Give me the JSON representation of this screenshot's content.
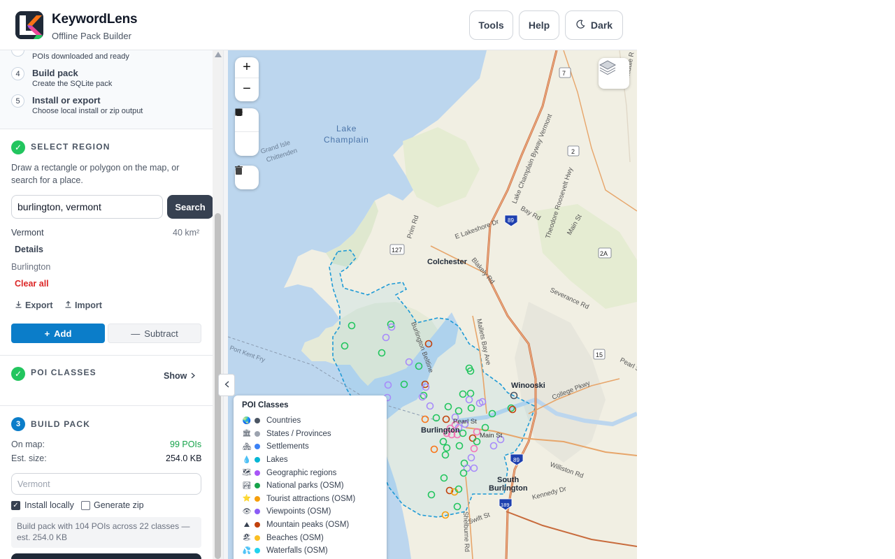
{
  "app": {
    "title": "KeywordLens",
    "subtitle": "Offline Pack Builder",
    "buttons": {
      "tools": "Tools",
      "help": "Help",
      "dark": "Dark"
    }
  },
  "steps": [
    {
      "num": "",
      "title": "",
      "desc": "POIs downloaded and ready"
    },
    {
      "num": "4",
      "title": "Build pack",
      "desc": "Create the SQLite pack"
    },
    {
      "num": "5",
      "title": "Install or export",
      "desc": "Choose local install or zip output"
    }
  ],
  "select_region": {
    "title": "SELECT REGION",
    "description": "Draw a rectangle or polygon on the map, or search for a place.",
    "search_value": "burlington, vermont",
    "search_button": "Search",
    "region_name": "Vermont",
    "region_area": "40 km²",
    "details_label": "Details",
    "place": "Burlington",
    "clear_all": "Clear all",
    "export_label": "Export",
    "import_label": "Import",
    "add_label": "Add",
    "subtract_label": "Subtract"
  },
  "poi_classes": {
    "title": "POI CLASSES",
    "show_label": "Show"
  },
  "build_pack": {
    "num": "3",
    "title": "BUILD PACK",
    "on_map_label": "On map:",
    "on_map_value": "99 POIs",
    "est_size_label": "Est. size:",
    "est_size_value": "254.0 KB",
    "name_placeholder": "Vermont",
    "install_locally": "Install locally",
    "generate_zip": "Generate zip",
    "summary": "Build pack with 104 POIs across 22 classes — est. 254.0 KB"
  },
  "map": {
    "zoom_in": "+",
    "zoom_out": "−",
    "labels": {
      "lake": "Lake",
      "champlain": "Champlain",
      "colchester": "Colchester",
      "winooski": "Winooski",
      "burlington": "Burlington",
      "south": "South",
      "south_burlington": "Burlington",
      "grand_isle": "Grand Isle",
      "chittenden": "Chittenden",
      "prim_rd": "Prim Rd",
      "lakeshore": "E Lakeshore Dr",
      "blakely": "Blakely Rd",
      "bay_rd": "Bay Rd",
      "main_st": "Main St",
      "severance": "Severance Rd",
      "mallets": "Mallets Bay Ave",
      "college": "College Pkwy",
      "pearl": "Pearl St",
      "williston": "Williston Rd",
      "kennedy": "Kennedy Dr",
      "swift": "Swift St",
      "port_kent": "Port Kent Fry",
      "beltline": "Burlington Beltline",
      "roosevelt": "Theodore Roosevelt Hwy",
      "byway": "Lake Champlain Byway Vermont",
      "pearl_st_city": "Pearl St",
      "main_st_city": "Main St",
      "shelburne": "Shelburne Rd",
      "middle": "Middle R",
      "rte7": "7",
      "rte2": "2",
      "rte127": "127",
      "rte2a": "2A",
      "rte15": "15",
      "i89a": "89",
      "i89b": "89",
      "i189": "189"
    }
  },
  "legend": {
    "title": "POI Classes",
    "items": [
      {
        "emoji": "🌏",
        "label": "Countries",
        "color": "#4b5563"
      },
      {
        "emoji": "🏛",
        "label": "States / Provinces",
        "color": "#9ca3af"
      },
      {
        "emoji": "🏘",
        "label": "Settlements",
        "color": "#3b82f6"
      },
      {
        "emoji": "💧",
        "label": "Lakes",
        "color": "#06b6d4"
      },
      {
        "emoji": "🗺",
        "label": "Geographic regions",
        "color": "#a855f7"
      },
      {
        "emoji": "🏞",
        "label": "National parks (OSM)",
        "color": "#16a34a"
      },
      {
        "emoji": "⭐",
        "label": "Tourist attractions (OSM)",
        "color": "#f59e0b"
      },
      {
        "emoji": "👁",
        "label": "Viewpoints (OSM)",
        "color": "#8b5cf6"
      },
      {
        "emoji": "⛰",
        "label": "Mountain peaks (OSM)",
        "color": "#c2410c"
      },
      {
        "emoji": "🏖",
        "label": "Beaches (OSM)",
        "color": "#fbbf24"
      },
      {
        "emoji": "💦",
        "label": "Waterfalls (OSM)",
        "color": "#22d3ee"
      }
    ]
  }
}
